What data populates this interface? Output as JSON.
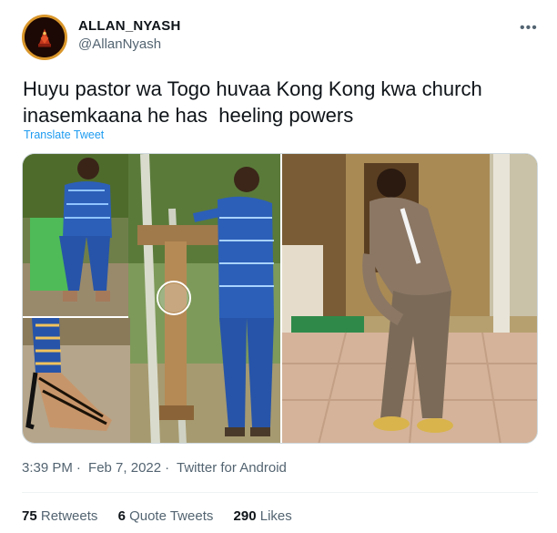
{
  "author": {
    "display_name": "ALLAN_NYASH",
    "handle": "@AllanNyash"
  },
  "menu_icon": "more-horizontal-icon",
  "tweet": {
    "text": "Huyu pastor wa Togo huvaa Kong Kong kwa church\ninasemkaana he has  heeling powers",
    "translate_label": "Translate Tweet"
  },
  "meta": {
    "time": "3:39 PM",
    "date": "Feb 7, 2022",
    "source": "Twitter for Android"
  },
  "stats": {
    "retweets_count": "75",
    "retweets_label": "Retweets",
    "quotes_count": "6",
    "quotes_label": "Quote Tweets",
    "likes_count": "290",
    "likes_label": "Likes"
  },
  "colors": {
    "link": "#1d9bf0",
    "secondary_text": "#536471",
    "avatar_ring": "#d9962a"
  }
}
